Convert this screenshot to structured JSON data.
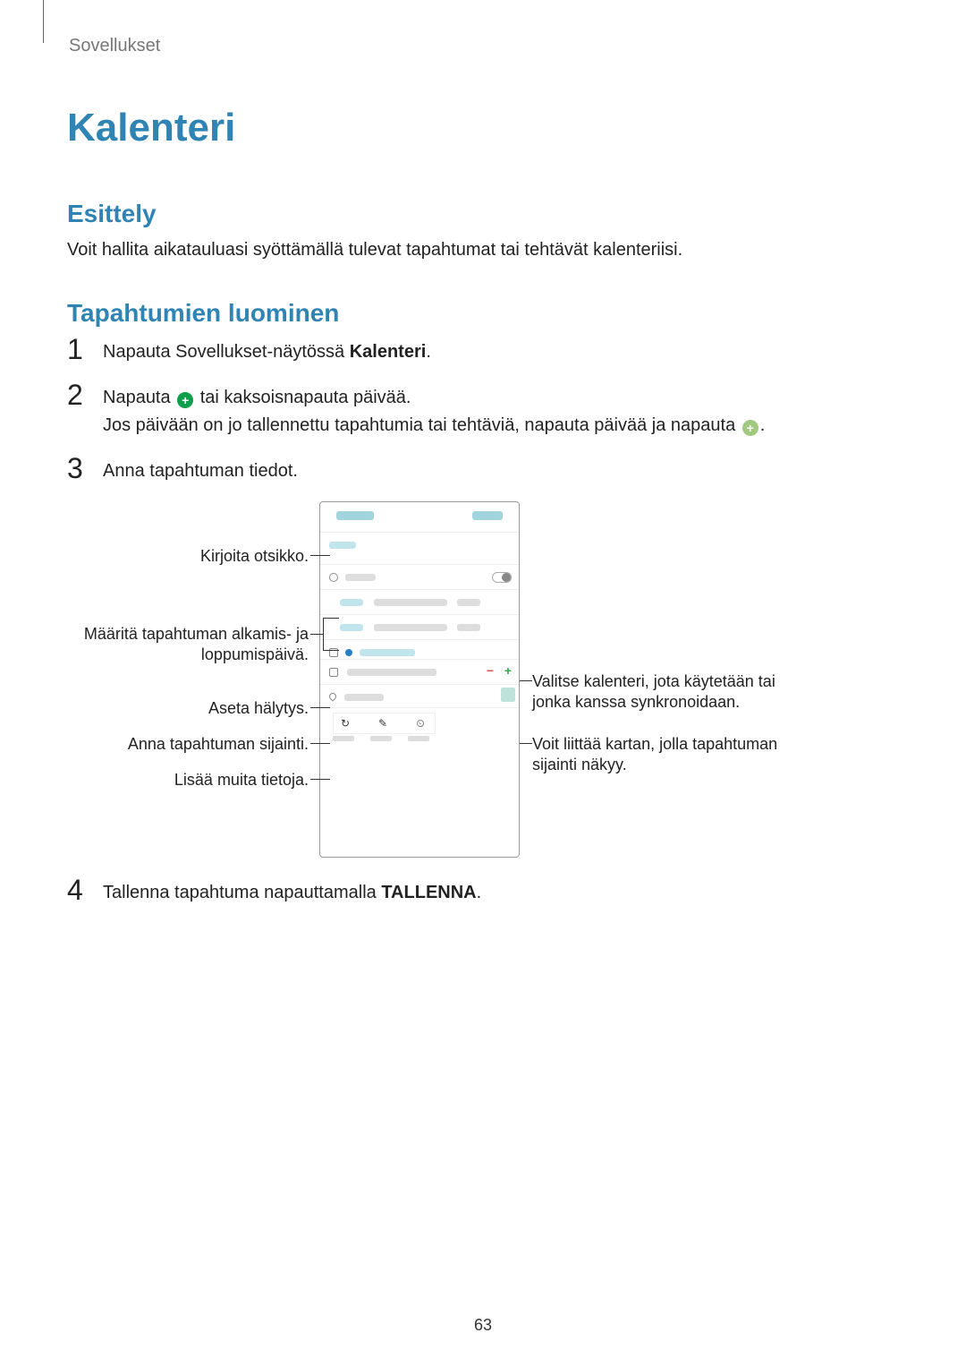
{
  "header": {
    "section": "Sovellukset"
  },
  "title": "Kalenteri",
  "intro": {
    "heading": "Esittely",
    "body": "Voit hallita aikatauluasi syöttämällä tulevat tapahtumat tai tehtävät kalenteriisi."
  },
  "create": {
    "heading": "Tapahtumien luominen",
    "steps": {
      "s1": {
        "num": "1",
        "text_pre": "Napauta Sovellukset-näytössä ",
        "bold": "Kalenteri",
        "text_post": "."
      },
      "s2": {
        "num": "2",
        "line1_a": "Napauta ",
        "line1_b": " tai kaksoisnapauta päivää.",
        "line2_a": "Jos päivään on jo tallennettu tapahtumia tai tehtäviä, napauta päivää ja napauta ",
        "line2_b": "."
      },
      "s3": {
        "num": "3",
        "text": "Anna tapahtuman tiedot."
      },
      "s4": {
        "num": "4",
        "text_pre": "Tallenna tapahtuma napauttamalla ",
        "bold": "TALLENNA",
        "text_post": "."
      }
    },
    "callouts": {
      "title_field": "Kirjoita otsikko.",
      "dates": "Määritä tapahtuman alkamis- ja loppumispäivä.",
      "alarm": "Aseta hälytys.",
      "location": "Anna tapahtuman sijainti.",
      "more": "Lisää muita tietoja.",
      "choose_cal": "Valitse kalenteri, jota käytetään tai jonka kanssa synkronoidaan.",
      "map": "Voit liittää kartan, jolla tapahtuman sijainti näkyy."
    }
  },
  "icons": {
    "plus": "+"
  },
  "page": "63"
}
